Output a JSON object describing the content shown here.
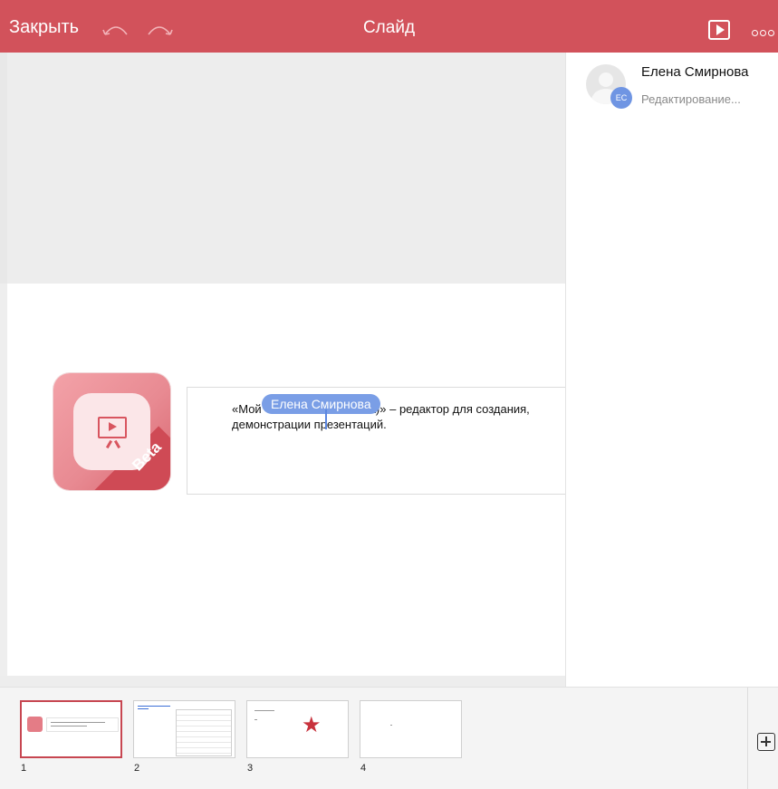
{
  "topbar": {
    "close_label": "Закрыть",
    "title": "Слайд",
    "undo_icon": "undo-arc-icon",
    "redo_icon": "redo-arc-icon",
    "play_icon": "play-icon",
    "more_icon": "more-dots-icon",
    "color": "#d2525b"
  },
  "slide": {
    "logo_badge": "Beta",
    "text_line1_before": "«Мой",
    "text_line1_after": "а)» – редактор для создания, ",
    "text_line2": "демонстрации презентаций.",
    "collaborator_tag": "Елена Смирнова",
    "collaborator_color": "#7a9ee6"
  },
  "panel": {
    "user_name": "Елена Смирнова",
    "user_initials": "ЕС",
    "user_status": "Редактирование..."
  },
  "thumbnails": [
    {
      "number": "1",
      "active": true
    },
    {
      "number": "2",
      "active": false
    },
    {
      "number": "3",
      "active": false
    },
    {
      "number": "4",
      "active": false
    }
  ],
  "add_slide_icon": "plus-box-icon"
}
